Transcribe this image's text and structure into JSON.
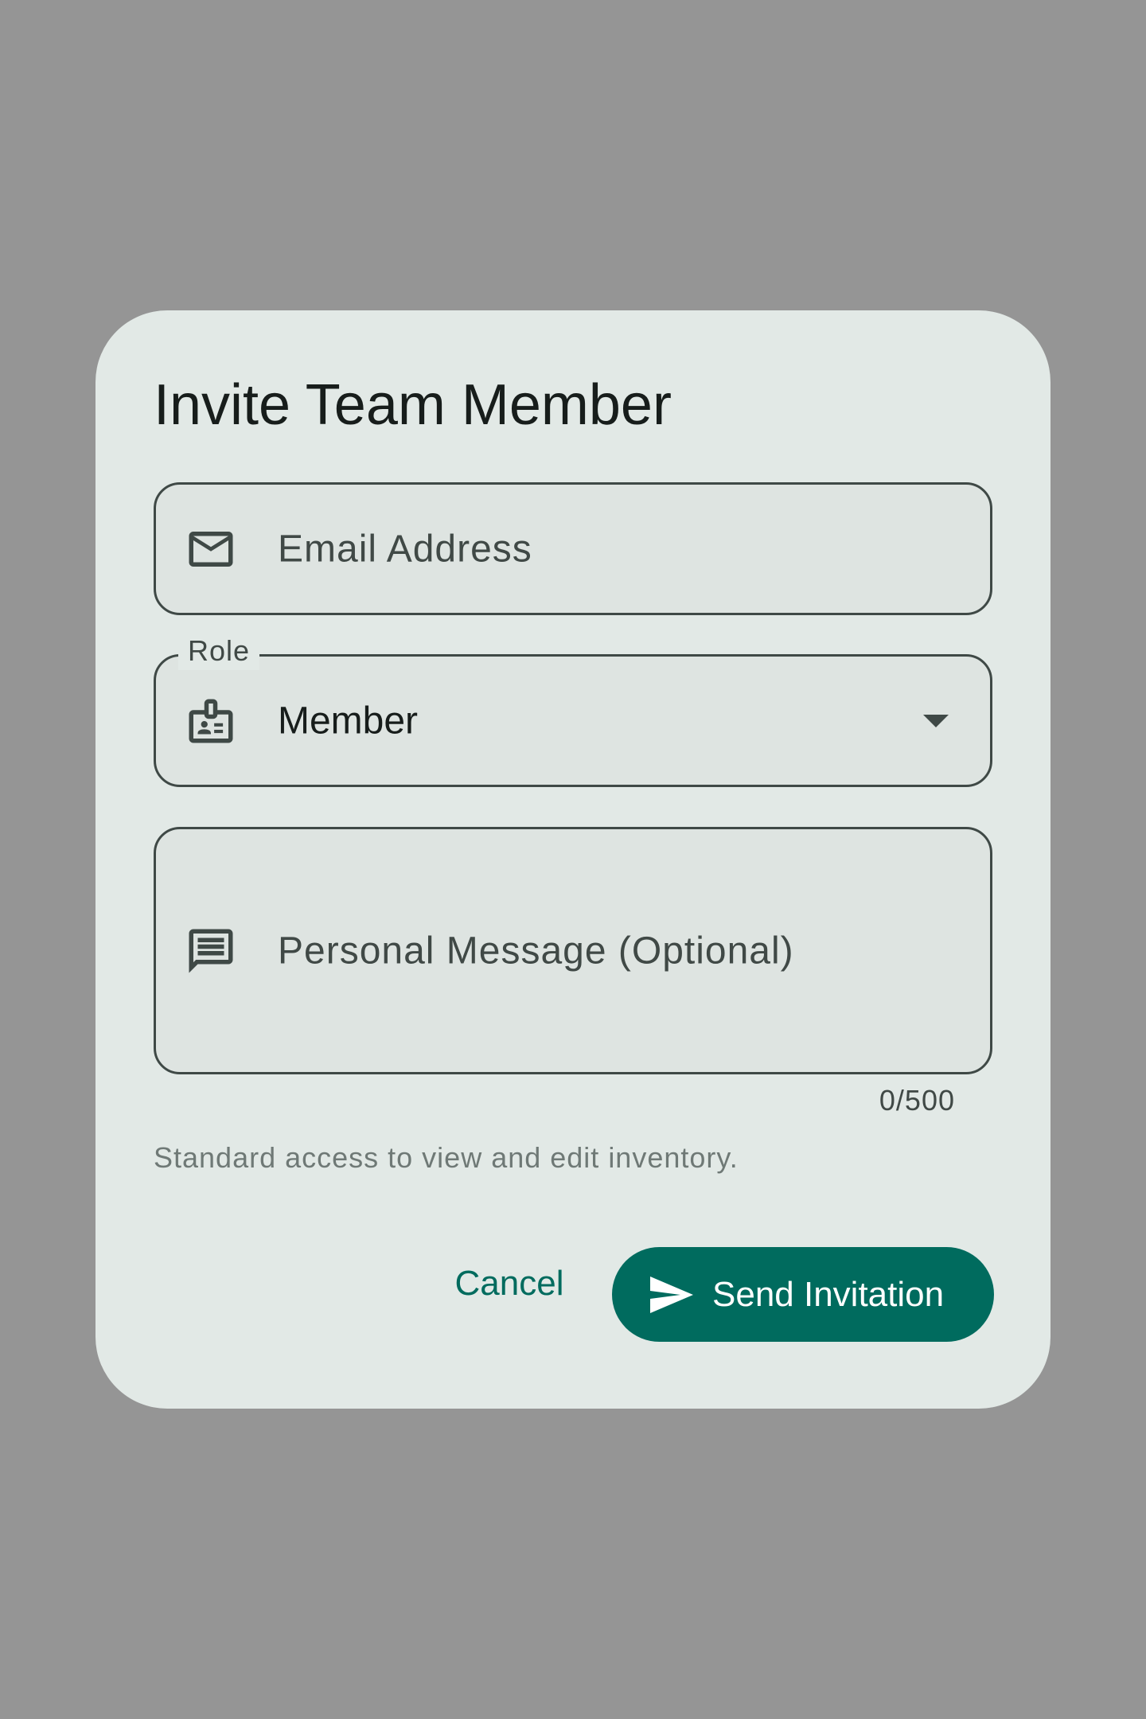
{
  "dialog": {
    "title": "Invite Team Member",
    "email": {
      "placeholder": "Email Address",
      "icon": "mail-icon"
    },
    "role": {
      "label": "Role",
      "value": "Member",
      "icon": "badge-icon"
    },
    "message": {
      "placeholder": "Personal Message (Optional)",
      "icon": "message-icon",
      "counter": "0/500"
    },
    "helper_text": "Standard access to view and edit inventory.",
    "actions": {
      "cancel_label": "Cancel",
      "send_label": "Send Invitation"
    }
  },
  "colors": {
    "scrim": "#959595",
    "surface": "#e2e9e6",
    "field_fill": "#dee4e1",
    "outline": "#3f4946",
    "primary": "#006b5e",
    "on_primary": "#ffffff"
  }
}
